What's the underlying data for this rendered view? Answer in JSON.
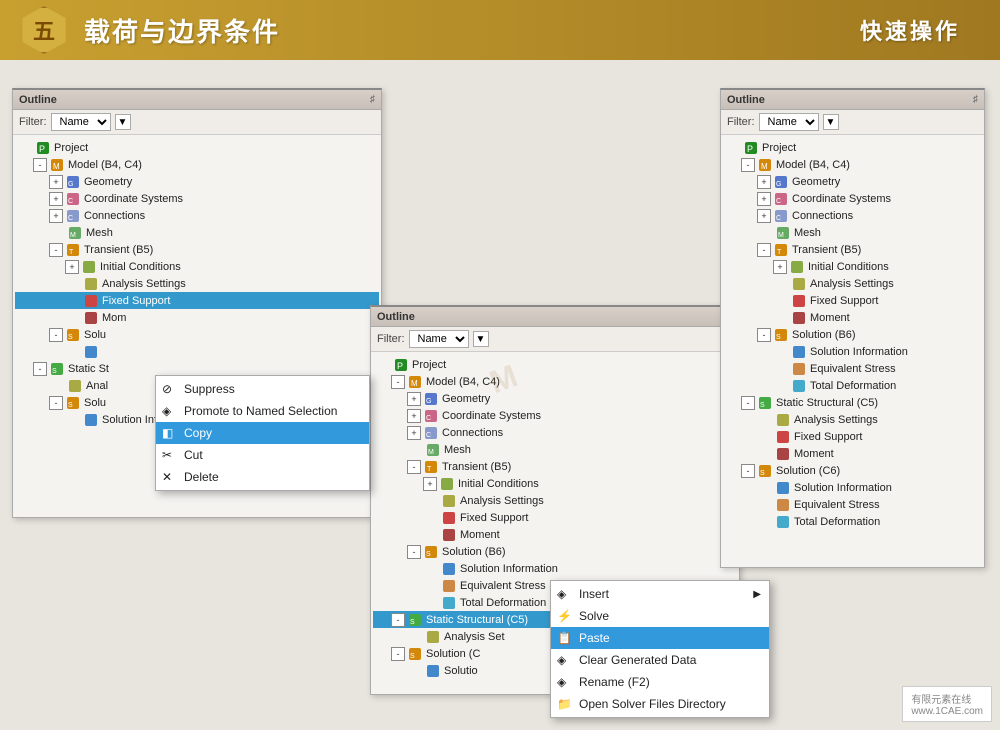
{
  "header": {
    "badge": "五",
    "title": "载荷与边界条件",
    "right_title": "快速操作"
  },
  "panel1": {
    "title": "Outline",
    "pin": "♯",
    "filter_label": "Filter:",
    "filter_value": "Name",
    "tree": [
      {
        "id": "p1",
        "level": 0,
        "expand": null,
        "icon": "🗂",
        "label": "Project",
        "type": "project"
      },
      {
        "id": "p2",
        "level": 1,
        "expand": "-",
        "icon": "⊡",
        "label": "Model (B4, C4)",
        "type": "model"
      },
      {
        "id": "p3",
        "level": 2,
        "expand": "+",
        "icon": "◈",
        "label": "Geometry",
        "type": "geometry"
      },
      {
        "id": "p4",
        "level": 2,
        "expand": "+",
        "icon": "⊕",
        "label": "Coordinate Systems",
        "type": "coord"
      },
      {
        "id": "p5",
        "level": 2,
        "expand": "+",
        "icon": "⊞",
        "label": "Connections",
        "type": "connections"
      },
      {
        "id": "p6",
        "level": 2,
        "expand": null,
        "icon": "⬡",
        "label": "Mesh",
        "type": "mesh"
      },
      {
        "id": "p7",
        "level": 2,
        "expand": "-",
        "icon": "⊡",
        "label": "Transient (B5)",
        "type": "transient"
      },
      {
        "id": "p8",
        "level": 3,
        "expand": "+",
        "icon": "◈",
        "label": "Initial Conditions",
        "type": "init"
      },
      {
        "id": "p9",
        "level": 3,
        "expand": null,
        "icon": "◈",
        "label": "Analysis Settings",
        "type": "analysis"
      },
      {
        "id": "p10",
        "level": 3,
        "expand": null,
        "icon": "◈",
        "label": "Fixed Support",
        "type": "fixed",
        "selected": true
      },
      {
        "id": "p11",
        "level": 3,
        "expand": null,
        "icon": "◈",
        "label": "Mom",
        "type": "moment"
      },
      {
        "id": "p12",
        "level": 2,
        "expand": "-",
        "icon": "⊡",
        "label": "Solu",
        "type": "solution"
      },
      {
        "id": "p13",
        "level": 3,
        "expand": null,
        "icon": "◈",
        "label": "",
        "type": "solinfo"
      },
      {
        "id": "p14",
        "level": 1,
        "expand": "-",
        "icon": "⊡",
        "label": "Static St",
        "type": "static"
      },
      {
        "id": "p15",
        "level": 2,
        "expand": null,
        "icon": "◈",
        "label": "Anal",
        "type": "analysis"
      },
      {
        "id": "p16",
        "level": 2,
        "expand": "-",
        "icon": "⊡",
        "label": "Solu",
        "type": "solution"
      },
      {
        "id": "p17",
        "level": 3,
        "expand": null,
        "icon": "◈",
        "label": "Solution Infor",
        "type": "solinfo"
      }
    ]
  },
  "panel2": {
    "title": "Outline",
    "pin": "♯",
    "filter_label": "Filter:",
    "filter_value": "Name",
    "tree": [
      {
        "id": "q1",
        "level": 0,
        "expand": null,
        "icon": "🗂",
        "label": "Project",
        "type": "project"
      },
      {
        "id": "q2",
        "level": 1,
        "expand": "-",
        "icon": "⊡",
        "label": "Model (B4, C4)",
        "type": "model"
      },
      {
        "id": "q3",
        "level": 2,
        "expand": "+",
        "icon": "◈",
        "label": "Geometry",
        "type": "geometry"
      },
      {
        "id": "q4",
        "level": 2,
        "expand": "+",
        "icon": "⊕",
        "label": "Coordinate Systems",
        "type": "coord"
      },
      {
        "id": "q5",
        "level": 2,
        "expand": "+",
        "icon": "⊞",
        "label": "Connections",
        "type": "connections"
      },
      {
        "id": "q6",
        "level": 2,
        "expand": null,
        "icon": "⬡",
        "label": "Mesh",
        "type": "mesh"
      },
      {
        "id": "q7",
        "level": 2,
        "expand": "-",
        "icon": "⊡",
        "label": "Transient (B5)",
        "type": "transient"
      },
      {
        "id": "q8",
        "level": 3,
        "expand": "+",
        "icon": "◈",
        "label": "Initial Conditions",
        "type": "init"
      },
      {
        "id": "q9",
        "level": 3,
        "expand": null,
        "icon": "◈",
        "label": "Analysis Settings",
        "type": "analysis"
      },
      {
        "id": "q10",
        "level": 3,
        "expand": null,
        "icon": "◈",
        "label": "Fixed Support",
        "type": "fixed"
      },
      {
        "id": "q11",
        "level": 3,
        "expand": null,
        "icon": "◈",
        "label": "Moment",
        "type": "moment"
      },
      {
        "id": "q12",
        "level": 2,
        "expand": "-",
        "icon": "⊡",
        "label": "Solution (B6)",
        "type": "solution"
      },
      {
        "id": "q13",
        "level": 3,
        "expand": null,
        "icon": "◈",
        "label": "Solution Information",
        "type": "solinfo"
      },
      {
        "id": "q14",
        "level": 3,
        "expand": null,
        "icon": "◈",
        "label": "Equivalent Stress",
        "type": "stress"
      },
      {
        "id": "q15",
        "level": 3,
        "expand": null,
        "icon": "◈",
        "label": "Total Deformation",
        "type": "deform"
      },
      {
        "id": "q16",
        "level": 1,
        "expand": "-",
        "icon": "⊡",
        "label": "Static Structural (C5)",
        "type": "static",
        "selected": true
      },
      {
        "id": "q17",
        "level": 2,
        "expand": null,
        "icon": "◈",
        "label": "Analysis Set",
        "type": "analysis"
      },
      {
        "id": "q18",
        "level": 1,
        "expand": "-",
        "icon": "⊡",
        "label": "Solution (C",
        "type": "solution"
      },
      {
        "id": "q19",
        "level": 2,
        "expand": null,
        "icon": "◈",
        "label": "Solutio",
        "type": "solinfo"
      }
    ]
  },
  "panel3": {
    "title": "Outline",
    "pin": "♯",
    "filter_label": "Filter:",
    "filter_value": "Name",
    "tree": [
      {
        "id": "r1",
        "level": 0,
        "expand": null,
        "icon": "🗂",
        "label": "Project",
        "type": "project"
      },
      {
        "id": "r2",
        "level": 1,
        "expand": "-",
        "icon": "⊡",
        "label": "Model (B4, C4)",
        "type": "model"
      },
      {
        "id": "r3",
        "level": 2,
        "expand": "+",
        "icon": "◈",
        "label": "Geometry",
        "type": "geometry"
      },
      {
        "id": "r4",
        "level": 2,
        "expand": "+",
        "icon": "⊕",
        "label": "Coordinate Systems",
        "type": "coord"
      },
      {
        "id": "r5",
        "level": 2,
        "expand": "+",
        "icon": "⊞",
        "label": "Connections",
        "type": "connections"
      },
      {
        "id": "r6",
        "level": 2,
        "expand": null,
        "icon": "⬡",
        "label": "Mesh",
        "type": "mesh"
      },
      {
        "id": "r7",
        "level": 2,
        "expand": "-",
        "icon": "⊡",
        "label": "Transient (B5)",
        "type": "transient"
      },
      {
        "id": "r8",
        "level": 3,
        "expand": "+",
        "icon": "◈",
        "label": "Initial Conditions",
        "type": "init"
      },
      {
        "id": "r9",
        "level": 3,
        "expand": null,
        "icon": "◈",
        "label": "Analysis Settings",
        "type": "analysis"
      },
      {
        "id": "r10",
        "level": 3,
        "expand": null,
        "icon": "◈",
        "label": "Fixed Support",
        "type": "fixed"
      },
      {
        "id": "r11",
        "level": 3,
        "expand": null,
        "icon": "◈",
        "label": "Moment",
        "type": "moment"
      },
      {
        "id": "r12",
        "level": 2,
        "expand": "-",
        "icon": "⊡",
        "label": "Solution (B6)",
        "type": "solution"
      },
      {
        "id": "r13",
        "level": 3,
        "expand": null,
        "icon": "◈",
        "label": "Solution Information",
        "type": "solinfo"
      },
      {
        "id": "r14",
        "level": 3,
        "expand": null,
        "icon": "◈",
        "label": "Equivalent Stress",
        "type": "stress"
      },
      {
        "id": "r15",
        "level": 3,
        "expand": null,
        "icon": "◈",
        "label": "Total Deformation",
        "type": "deform"
      },
      {
        "id": "r16",
        "level": 1,
        "expand": "-",
        "icon": "⊡",
        "label": "Static Structural (C5)",
        "type": "static"
      },
      {
        "id": "r17",
        "level": 2,
        "expand": null,
        "icon": "◈",
        "label": "Analysis Settings",
        "type": "analysis"
      },
      {
        "id": "r18",
        "level": 2,
        "expand": null,
        "icon": "◈",
        "label": "Fixed Support",
        "type": "fixed"
      },
      {
        "id": "r19",
        "level": 2,
        "expand": null,
        "icon": "◈",
        "label": "Moment",
        "type": "moment"
      },
      {
        "id": "r20",
        "level": 1,
        "expand": "-",
        "icon": "⊡",
        "label": "Solution (C6)",
        "type": "solution"
      },
      {
        "id": "r21",
        "level": 2,
        "expand": null,
        "icon": "◈",
        "label": "Solution Information",
        "type": "solinfo"
      },
      {
        "id": "r22",
        "level": 2,
        "expand": null,
        "icon": "◈",
        "label": "Equivalent Stress",
        "type": "stress"
      },
      {
        "id": "r23",
        "level": 2,
        "expand": null,
        "icon": "◈",
        "label": "Total Deformation",
        "type": "deform"
      }
    ]
  },
  "ctx1": {
    "items": [
      {
        "label": "Suppress",
        "icon": "⊘",
        "type": "normal",
        "separator_after": false
      },
      {
        "label": "Promote to Named Selection",
        "icon": "◈",
        "type": "normal",
        "separator_after": false
      },
      {
        "label": "Copy",
        "icon": "◧",
        "type": "highlighted",
        "separator_after": false
      },
      {
        "label": "Cut",
        "icon": "✂",
        "type": "normal",
        "separator_after": false
      },
      {
        "label": "Delete",
        "icon": "✕",
        "type": "normal",
        "separator_after": false
      }
    ]
  },
  "ctx2": {
    "items": [
      {
        "label": "Insert",
        "icon": "◈",
        "type": "normal",
        "has_arrow": true,
        "separator_after": false
      },
      {
        "label": "Solve",
        "icon": "⚡",
        "type": "normal",
        "separator_after": false
      },
      {
        "label": "Paste",
        "icon": "📋",
        "type": "highlighted",
        "separator_after": false
      },
      {
        "label": "Clear Generated Data",
        "icon": "◈",
        "type": "normal",
        "separator_after": false
      },
      {
        "label": "Rename (F2)",
        "icon": "◈",
        "type": "normal",
        "separator_after": false
      },
      {
        "label": "Open Solver Files Directory",
        "icon": "📁",
        "type": "normal",
        "separator_after": false
      }
    ]
  },
  "watermark": "M",
  "logo": {
    "line1": "有限元素在线",
    "line2": "www.1CAE.com"
  }
}
